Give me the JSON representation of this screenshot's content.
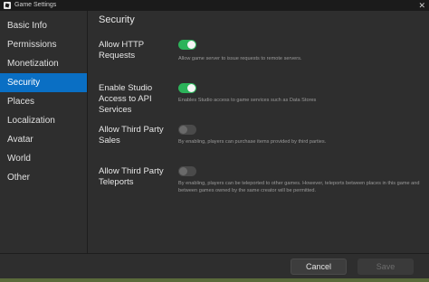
{
  "window": {
    "title": "Game Settings",
    "close_glyph": "✕"
  },
  "sidebar": {
    "items": [
      {
        "label": "Basic Info",
        "active": false
      },
      {
        "label": "Permissions",
        "active": false
      },
      {
        "label": "Monetization",
        "active": false
      },
      {
        "label": "Security",
        "active": true
      },
      {
        "label": "Places",
        "active": false
      },
      {
        "label": "Localization",
        "active": false
      },
      {
        "label": "Avatar",
        "active": false
      },
      {
        "label": "World",
        "active": false
      },
      {
        "label": "Other",
        "active": false
      }
    ]
  },
  "main": {
    "section_title": "Security",
    "settings": [
      {
        "label": "Allow HTTP Requests",
        "enabled": true,
        "description": "Allow game server to issue requests to remote servers."
      },
      {
        "label": "Enable Studio Access to API Services",
        "enabled": true,
        "description": "Enables Studio access to game services such as Data Stores"
      },
      {
        "label": "Allow Third Party Sales",
        "enabled": false,
        "description": "By enabling, players can purchase items provided by third parties."
      },
      {
        "label": "Allow Third Party Teleports",
        "enabled": false,
        "description": "By enabling, players can be teleported to other games. However, teleports between places in this game and between games owned by the same creator will be permitted."
      }
    ]
  },
  "footer": {
    "cancel_label": "Cancel",
    "save_label": "Save",
    "save_disabled": true
  },
  "colors": {
    "accent": "#0a6fc4",
    "toggle_on": "#2cb35a",
    "background": "#2e2e2e"
  }
}
